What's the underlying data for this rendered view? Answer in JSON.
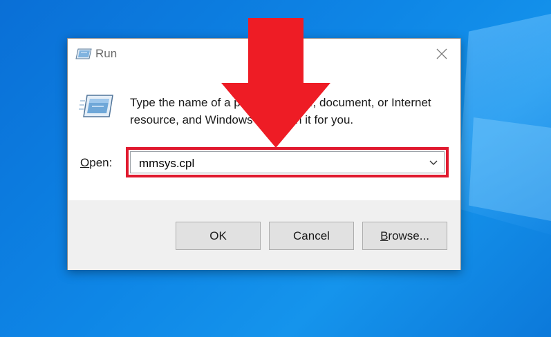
{
  "dialog": {
    "title": "Run",
    "description": "Type the name of a program, folder, document, or Internet resource, and Windows will open it for you.",
    "open_label_accel": "O",
    "open_label_rest": "pen:",
    "open_value": "mmsys.cpl",
    "buttons": {
      "ok": "OK",
      "cancel": "Cancel",
      "browse_accel": "B",
      "browse_rest": "rowse..."
    }
  },
  "icons": {
    "title": "run-icon",
    "body": "run-icon",
    "close": "close-icon",
    "dropdown": "chevron-down-icon",
    "annotation": "arrow-down-icon"
  },
  "colors": {
    "highlight": "#e0192e",
    "arrow": "#ee1c25",
    "desktop": "#0e86e6"
  }
}
